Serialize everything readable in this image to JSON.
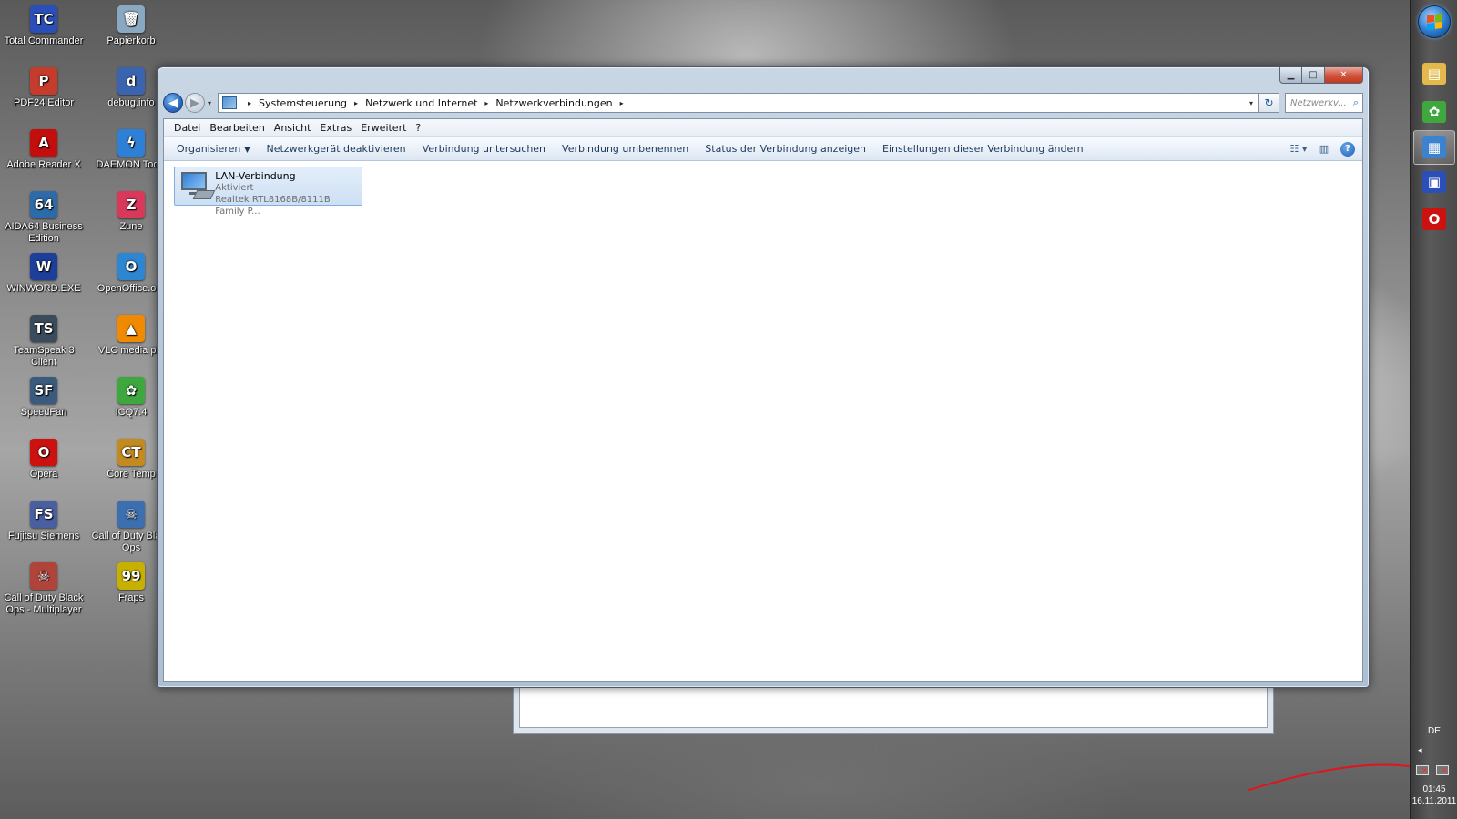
{
  "desktop": {
    "icons": [
      {
        "label": "Total Commander",
        "color": "#2a4fb8",
        "glyph": "TC"
      },
      {
        "label": "Papierkorb",
        "color": "#8aa8c2",
        "glyph": "🗑"
      },
      {
        "label": "PDF24 Editor",
        "color": "#c53b2c",
        "glyph": "P"
      },
      {
        "label": "debug.info",
        "color": "#3b64b0",
        "glyph": "d"
      },
      {
        "label": "Adobe Reader X",
        "color": "#c40d0d",
        "glyph": "A"
      },
      {
        "label": "DAEMON Tools",
        "color": "#2e7fd6",
        "glyph": "ϟ"
      },
      {
        "label": "AIDA64 Business Edition",
        "color": "#2d6aa8",
        "glyph": "64"
      },
      {
        "label": "Zune",
        "color": "#d8395b",
        "glyph": "Z"
      },
      {
        "label": "WINWORD.EXE",
        "color": "#1d3f9a",
        "glyph": "W"
      },
      {
        "label": "OpenOffice.org",
        "color": "#2f86d0",
        "glyph": "O"
      },
      {
        "label": "TeamSpeak 3 Client",
        "color": "#3a4b5c",
        "glyph": "TS"
      },
      {
        "label": "VLC media pla",
        "color": "#f08a00",
        "glyph": "▲"
      },
      {
        "label": "SpeedFan",
        "color": "#3a5b7e",
        "glyph": "SF"
      },
      {
        "label": "ICQ7.4",
        "color": "#3ea83e",
        "glyph": "✿"
      },
      {
        "label": "Opera",
        "color": "#cc1111",
        "glyph": "O"
      },
      {
        "label": "Core Temp",
        "color": "#c28a1f",
        "glyph": "CT"
      },
      {
        "label": "Fujitsu Siemens",
        "color": "#4a5fa0",
        "glyph": "FS"
      },
      {
        "label": "Call of Duty Black Ops",
        "color": "#3b6fb0",
        "glyph": "☠"
      },
      {
        "label": "Call of Duty Black Ops - Multiplayer",
        "color": "#b0443b",
        "glyph": "☠"
      },
      {
        "label": "Fraps",
        "color": "#c8b000",
        "glyph": "99"
      }
    ]
  },
  "window": {
    "caption_buttons": {
      "minimize": "▁",
      "maximize": "□",
      "close": "✕"
    },
    "nav": {
      "back": "◀",
      "forward": "▶",
      "recent": "▾"
    },
    "address": {
      "crumbs": [
        "Systemsteuerung",
        "Netzwerk und Internet",
        "Netzwerkverbindungen"
      ],
      "separator": "▸",
      "dropdown": "▾",
      "refresh": "↻"
    },
    "search": {
      "placeholder": "Netzwerkv...",
      "icon": "⌕"
    },
    "menubar": [
      "Datei",
      "Bearbeiten",
      "Ansicht",
      "Extras",
      "Erweitert",
      "?"
    ],
    "toolbar": {
      "organize": "Organisieren",
      "organize_caret": "▼",
      "items": [
        "Netzwerkgerät deaktivieren",
        "Verbindung untersuchen",
        "Verbindung umbenennen",
        "Status der Verbindung anzeigen",
        "Einstellungen dieser Verbindung ändern"
      ],
      "view_icon": "☷ ▾",
      "pane_icon": "▥",
      "help_icon": "?"
    },
    "connection": {
      "name": "LAN-Verbindung",
      "status": "Aktiviert",
      "device": "Realtek RTL8168B/8111B Family P..."
    }
  },
  "taskbar": {
    "pinned": [
      {
        "name": "explorer",
        "color": "#e2b94a",
        "glyph": "▤"
      },
      {
        "name": "icq",
        "color": "#3ea83e",
        "glyph": "✿"
      },
      {
        "name": "control-panel",
        "color": "#3d82cf",
        "glyph": "▦"
      },
      {
        "name": "total-commander",
        "color": "#2a4fb8",
        "glyph": "▣"
      },
      {
        "name": "opera",
        "color": "#cc1111",
        "glyph": "O"
      }
    ],
    "language": "DE",
    "tray_arrow": "◂",
    "time": "01:45",
    "date": "16.11.2011"
  },
  "colors": {
    "annotation_line": "#e0141e",
    "windows_flag": [
      "#f25022",
      "#7fba00",
      "#00a4ef",
      "#ffb900"
    ]
  }
}
